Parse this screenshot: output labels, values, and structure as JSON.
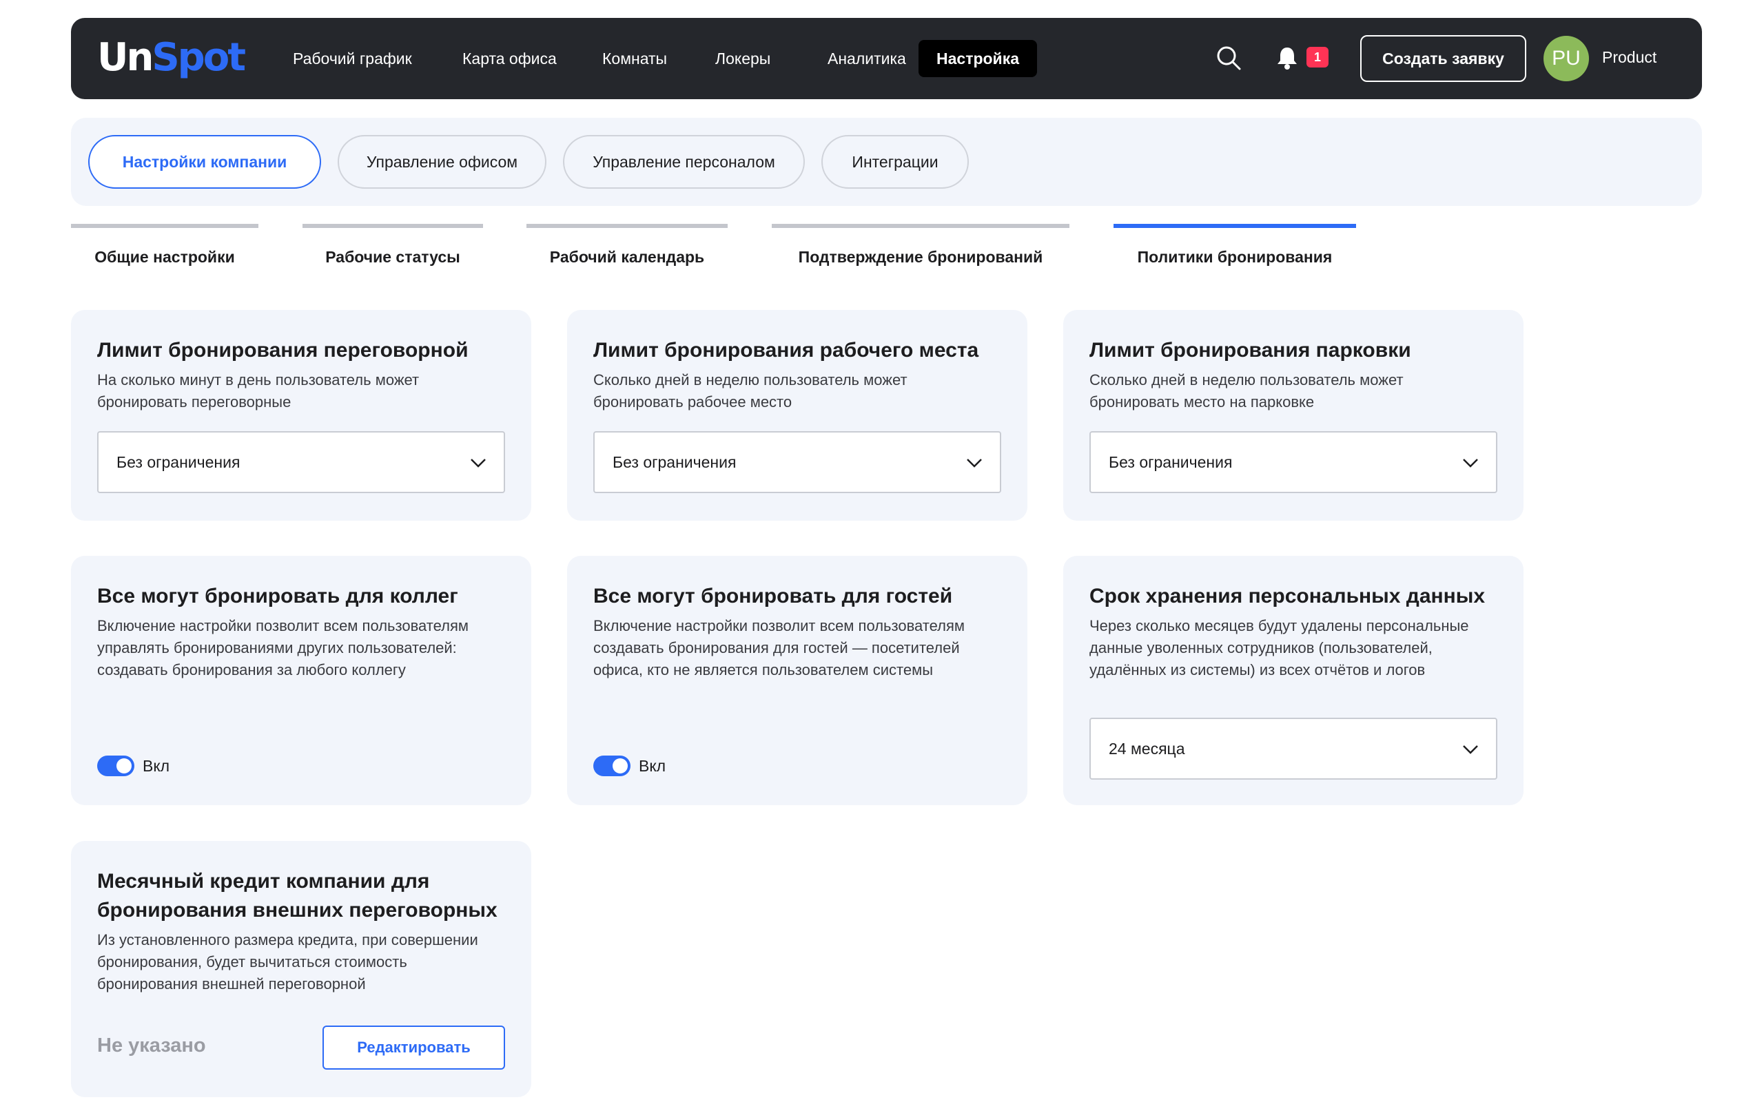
{
  "header": {
    "logo_un": "Un",
    "logo_spot": "Spot",
    "nav": [
      {
        "label": "Рабочий график"
      },
      {
        "label": "Карта офиса"
      },
      {
        "label": "Комнаты"
      },
      {
        "label": "Локеры"
      },
      {
        "label": "Аналитика"
      },
      {
        "label": "Настройка",
        "active": true
      }
    ],
    "notification_count": "1",
    "create_button": "Создать заявку",
    "avatar_initials": "PU",
    "user_name": "Product"
  },
  "settings_tabs": [
    {
      "label": "Настройки компании",
      "active": true
    },
    {
      "label": "Управление офисом"
    },
    {
      "label": "Управление персоналом"
    },
    {
      "label": "Интеграции"
    }
  ],
  "sub_tabs": [
    {
      "label": "Общие настройки"
    },
    {
      "label": "Рабочие статусы"
    },
    {
      "label": "Рабочий календарь"
    },
    {
      "label": "Подтверждение бронирований"
    },
    {
      "label": "Политики бронирования",
      "active": true
    }
  ],
  "cards": {
    "meeting_limit": {
      "title": "Лимит бронирования переговорной",
      "desc": "На сколько минут в день пользователь может бронировать переговорные",
      "value": "Без ограничения"
    },
    "desk_limit": {
      "title": "Лимит бронирования рабочего места",
      "desc": "Сколько дней в неделю пользователь может бронировать рабочее место",
      "value": "Без ограничения"
    },
    "parking_limit": {
      "title": "Лимит бронирования парковки",
      "desc": "Сколько дней в неделю пользователь может бронировать место на парковке",
      "value": "Без ограничения"
    },
    "book_for_colleagues": {
      "title": "Все могут бронировать для коллег",
      "desc": "Включение настройки позволит всем пользователям управлять бронированиями других пользователей: создавать бронирования за любого коллегу",
      "toggle_label": "Вкл",
      "enabled": true
    },
    "book_for_guests": {
      "title": "Все могут бронировать для гостей",
      "desc": "Включение настройки позволит всем пользователям создавать бронирования для гостей — посетителей офиса, кто не является пользователем системы",
      "toggle_label": "Вкл",
      "enabled": true
    },
    "data_retention": {
      "title": "Срок хранения персональных данных",
      "desc": "Через сколько месяцев будут удалены персональные данные уволенных сотрудников (пользователей, удалённых из системы) из всех отчётов и логов",
      "value": "24 месяца"
    },
    "monthly_credit": {
      "title": "Месячный кредит компании для бронирования внешних переговорных",
      "desc": "Из установленного размера кредита, при совершении бронирования, будет вычитаться стоимость бронирования внешней переговорной",
      "value": "Не указано",
      "edit_button": "Редактировать"
    }
  },
  "colors": {
    "accent": "#2d6bf6",
    "topbar": "#25272c",
    "card_bg": "#f2f5fb",
    "badge": "#ff3355",
    "avatar": "#8cba5a"
  }
}
